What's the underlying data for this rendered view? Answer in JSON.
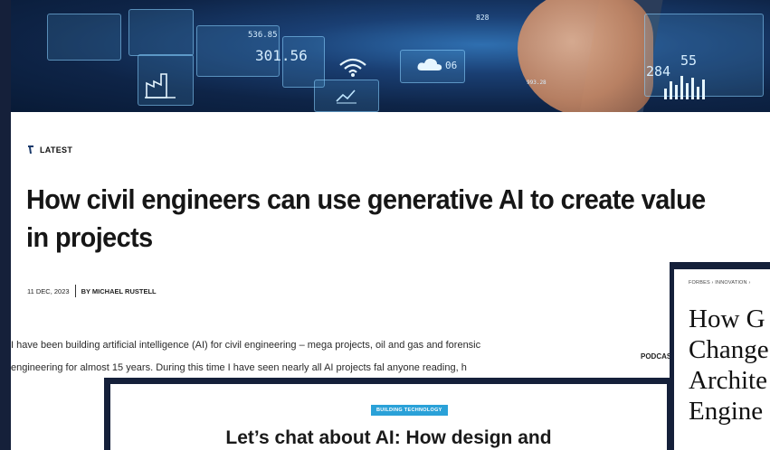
{
  "article": {
    "section_label": "LATEST",
    "headline": "How civil engineers can use generative AI to create value in projects",
    "date": "11 DEC, 2023",
    "author": "BY MICHAEL RUSTELL",
    "body": "I have been building artificial intelligence (AI) for civil engineering – mega projects, oil and gas and forensic engineering for almost 15 years. During this time I have seen nearly all AI projects fal anyone reading, h"
  },
  "hero_numbers": [
    "536.85",
    "301.56",
    "06",
    "828",
    "284",
    "55",
    "993.28"
  ],
  "forbes": {
    "breadcrumb": "FORBES › INNOVATION ›",
    "title_lines": [
      "How G",
      "Change",
      "Archite",
      "Engine"
    ]
  },
  "side_label": "PODCAS",
  "overlay": {
    "badge": "BUILDING TECHNOLOGY",
    "title": "Let’s chat about AI: How design and"
  },
  "colors": {
    "background": "#15203a",
    "badge": "#2aa1d8",
    "text_dark": "#161616"
  },
  "icons": {
    "latest": "bookmark-arrow-icon"
  }
}
